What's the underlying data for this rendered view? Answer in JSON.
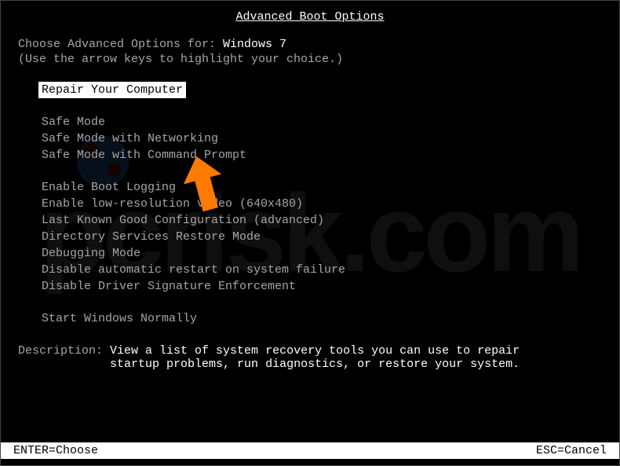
{
  "title": "Advanced Boot Options",
  "prompt_prefix": "Choose Advanced Options for: ",
  "os_name": "Windows 7",
  "instruction": "(Use the arrow keys to highlight your choice.)",
  "menu": {
    "selected": "Repair Your Computer",
    "group1": [
      "Safe Mode",
      "Safe Mode with Networking",
      "Safe Mode with Command Prompt"
    ],
    "group2": [
      "Enable Boot Logging",
      "Enable low-resolution video (640x480)",
      "Last Known Good Configuration (advanced)",
      "Directory Services Restore Mode",
      "Debugging Mode",
      "Disable automatic restart on system failure",
      "Disable Driver Signature Enforcement"
    ],
    "group3": [
      "Start Windows Normally"
    ]
  },
  "description_label": "Description: ",
  "description_text_line1": "View a list of system recovery tools you can use to repair",
  "description_text_line2": "startup problems, run diagnostics, or restore your system.",
  "footer": {
    "enter": "ENTER=Choose",
    "esc": "ESC=Cancel"
  },
  "watermark": "pcrisk.com"
}
